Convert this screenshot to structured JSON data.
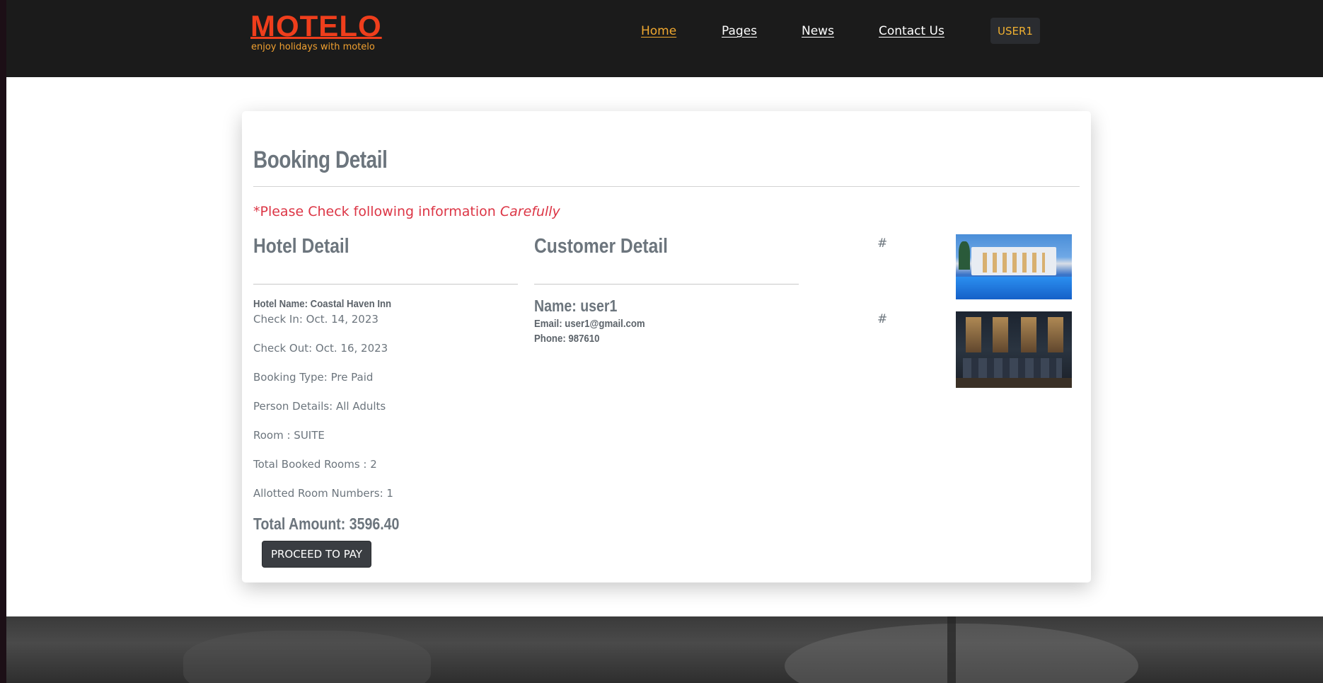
{
  "header": {
    "logo": {
      "brand": "MOTELO",
      "tagline": "enjoy holidays with motelo"
    },
    "nav": [
      {
        "label": "Home",
        "active": true
      },
      {
        "label": "Pages",
        "active": false
      },
      {
        "label": "News",
        "active": false
      },
      {
        "label": "Contact Us",
        "active": false
      }
    ],
    "user_label": "USER1"
  },
  "booking": {
    "title": "Booking Detail",
    "notice": "*Please Check following information",
    "notice_emphasis": "Carefully",
    "hotel": {
      "section_title": "Hotel Detail",
      "hotel_name": "Hotel Name: Coastal Haven Inn",
      "check_in": "Check In: Oct. 14, 2023",
      "check_out": "Check Out: Oct. 16, 2023",
      "booking_type": "Booking Type: Pre Paid",
      "person_details": "Person Details: All Adults",
      "room": "Room : SUITE",
      "total_rooms": "Total Booked Rooms : 2",
      "allotted_rooms": "Allotted Room Numbers: 1",
      "total_amount": "Total Amount: 3596.40"
    },
    "customer": {
      "section_title": "Customer Detail",
      "name": "Name: user1",
      "email": "Email: user1@gmail.com",
      "phone": "Phone: 987610"
    },
    "images": [
      {
        "link": "#",
        "alt": "hotel exterior with pool"
      },
      {
        "link": "#",
        "alt": "restaurant interior"
      }
    ],
    "pay_button": "PROCEED TO PAY"
  },
  "colors": {
    "logo": "#ef3e1c",
    "accent": "#f0a830",
    "notice": "#dc3545",
    "heading": "#6c757d",
    "button": "#3a3d42"
  }
}
